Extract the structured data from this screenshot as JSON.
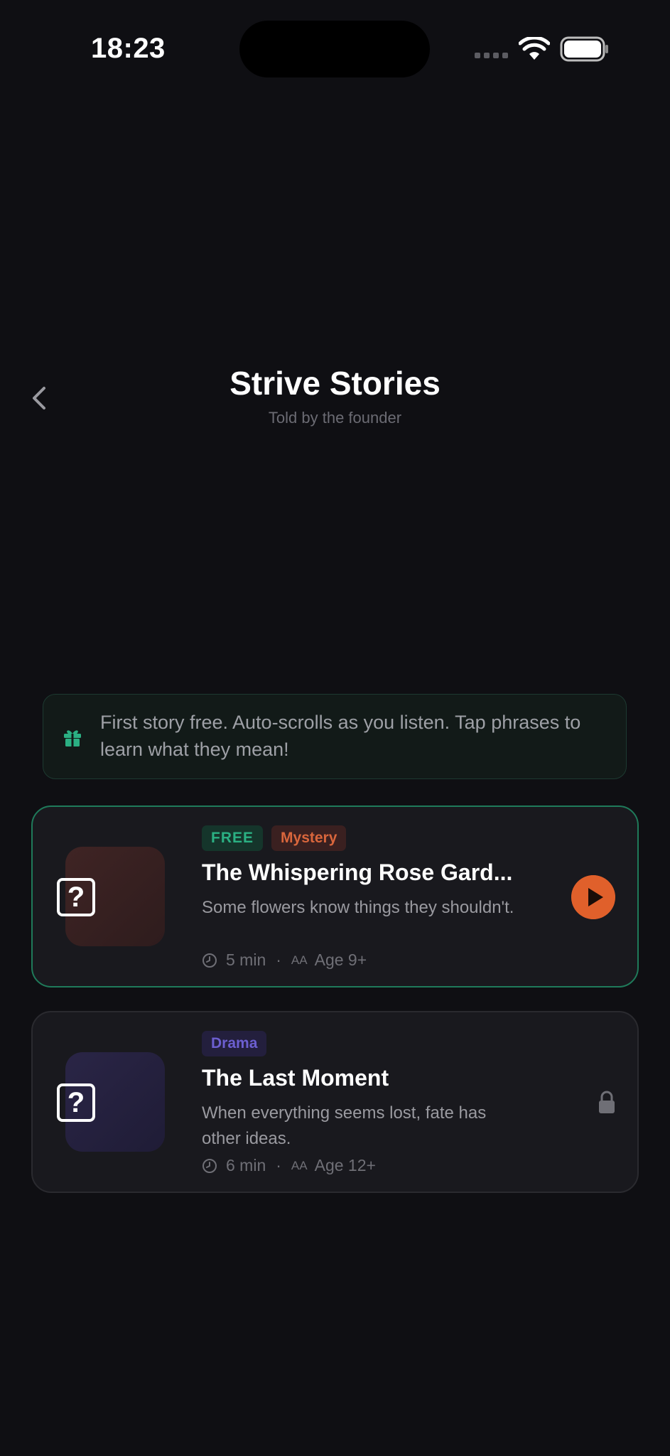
{
  "status_bar": {
    "time": "18:23"
  },
  "header": {
    "title": "Strive Stories",
    "subtitle": "Told by the founder"
  },
  "banner": {
    "icon": "gift-icon",
    "text": "First story free. Auto-scrolls as you listen. Tap phrases to learn what they mean!"
  },
  "stories": [
    {
      "tags": [
        "FREE",
        "Mystery"
      ],
      "title": "The Whispering Rose Gard...",
      "description": "Some flowers know things they shouldn't.",
      "duration": "5 min",
      "age": "Age 9+",
      "action": "play",
      "thumb_color": "#3a2223",
      "unlocked": true
    },
    {
      "tags": [
        "Drama"
      ],
      "title": "The Last Moment",
      "description": "When everything seems lost, fate has other ideas.",
      "duration": "6 min",
      "age": "Age 12+",
      "action": "locked",
      "thumb_color": "#25213f",
      "unlocked": false
    }
  ],
  "colors": {
    "accent_green": "#2bb083",
    "accent_orange": "#e0602b",
    "background": "#0f0f13"
  }
}
